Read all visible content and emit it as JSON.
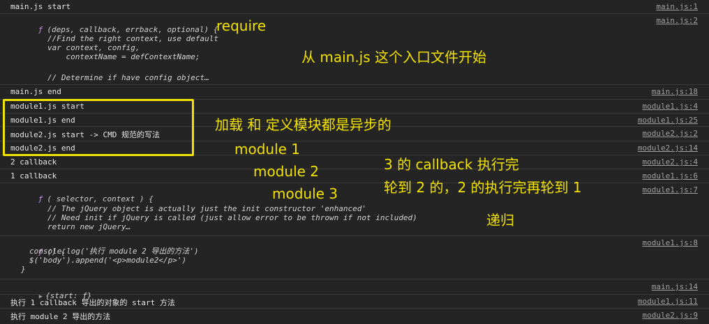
{
  "rows": [
    {
      "text": "main.js start",
      "src": "main.js:1"
    },
    {
      "sig": "(deps, callback, errback, optional) {",
      "src": "main.js:2",
      "code": [
        "//Find the right context, use default",
        "var context, config,",
        "    contextName = defContextName;",
        "",
        "// Determine if have config object…"
      ]
    },
    {
      "text": "main.js end",
      "src": "main.js:18"
    },
    {
      "text": "module1.js start",
      "src": "module1.js:4"
    },
    {
      "text": "module1.js end",
      "src": "module1.js:25"
    },
    {
      "text": "module2.js start -> CMD 规范的写法",
      "src": "module2.js:2"
    },
    {
      "text": "module2.js end",
      "src": "module2.js:14"
    },
    {
      "text": "2 callback",
      "src": "module2.js:4"
    },
    {
      "text": "1 callback",
      "src": "module1.js:6"
    },
    {
      "sig": "( selector, context ) {",
      "src": "module1.js:7",
      "code": [
        "// The jQuery object is actually just the init constructor 'enhanced'",
        "// Need init if jQuery is called (just allow error to be thrown if not included)",
        "return new jQuery…"
      ]
    },
    {
      "sig": "() {",
      "src": "module1.js:8",
      "code": [
        "console.log('执行 module 2 导出的方法')",
        "$('body').append('<p>module2</p>')",
        "}"
      ]
    },
    {
      "obj": "{start: ƒ}",
      "src": "main.js:14"
    },
    {
      "text": "执行 1 callback 导出的对象的 start 方法",
      "src": "module1.js:11"
    },
    {
      "text": "执行 module 2 导出的方法",
      "src": "module2.js:9"
    }
  ],
  "fn_glyph": "ƒ",
  "annotations": {
    "require": "require",
    "entry": "从 main.js 这个入口文件开始",
    "async": "加载 和 定义模块都是异步的",
    "module1": "module 1",
    "module2": "module 2",
    "module3": "module 3",
    "cb1": "3 的 callback 执行完",
    "cb2": "轮到 2 的，2 的执行完再轮到 1",
    "recursion": "递归"
  },
  "colors": {
    "background": "#242424",
    "annotation": "#f2e200",
    "function_glyph": "#c792ea"
  }
}
